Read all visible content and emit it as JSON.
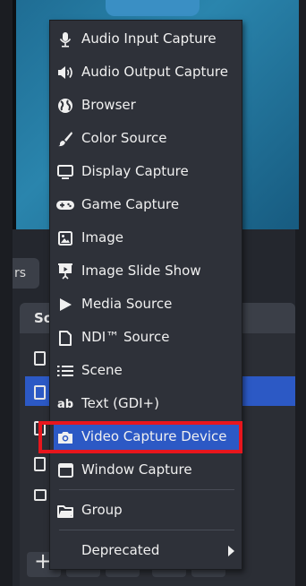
{
  "background": {
    "scenes_tab_fragment": "rs",
    "sources_panel_title": "So"
  },
  "menu": {
    "items": [
      {
        "label": "Audio Input Capture",
        "icon": "microphone-icon"
      },
      {
        "label": "Audio Output Capture",
        "icon": "speaker-icon"
      },
      {
        "label": "Browser",
        "icon": "globe-icon"
      },
      {
        "label": "Color Source",
        "icon": "paintbrush-icon"
      },
      {
        "label": "Display Capture",
        "icon": "monitor-icon"
      },
      {
        "label": "Game Capture",
        "icon": "gamepad-icon"
      },
      {
        "label": "Image",
        "icon": "image-icon"
      },
      {
        "label": "Image Slide Show",
        "icon": "slideshow-icon"
      },
      {
        "label": "Media Source",
        "icon": "play-icon"
      },
      {
        "label": "NDI™ Source",
        "icon": "document-icon"
      },
      {
        "label": "Scene",
        "icon": "list-icon"
      },
      {
        "label": "Text (GDI+)",
        "icon": "text-ab-icon"
      },
      {
        "label": "Video Capture Device",
        "icon": "camera-icon",
        "highlighted": true
      },
      {
        "label": "Window Capture",
        "icon": "window-icon"
      },
      {
        "label": "Group",
        "icon": "folder-icon"
      },
      {
        "label": "Deprecated",
        "submenu": true
      }
    ]
  },
  "colors": {
    "highlight": "#2c59c5",
    "annotation_box": "#e8161d",
    "menu_background": "#2e3139"
  }
}
